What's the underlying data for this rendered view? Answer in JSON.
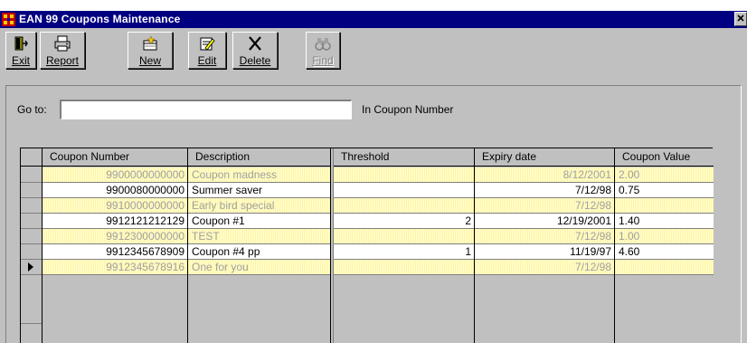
{
  "window": {
    "title": "EAN 99 Coupons Maintenance",
    "titlebar_color": "#000080",
    "close_glyph": "✕"
  },
  "toolbar": {
    "buttons": [
      {
        "label": "Exit",
        "icon": "exit-door-icon"
      },
      {
        "label": "Report",
        "icon": "printer-icon"
      },
      {
        "label": "New",
        "icon": "new-record-icon"
      },
      {
        "label": "Edit",
        "icon": "edit-record-icon"
      },
      {
        "label": "Delete",
        "icon": "delete-x-icon"
      },
      {
        "label": "Find",
        "icon": "binoculars-icon",
        "enabled": false
      }
    ]
  },
  "goto": {
    "label": "Go to:",
    "value": "",
    "suffix": "In Coupon Number"
  },
  "grid": {
    "columns": [
      "Coupon Number",
      "Description",
      "Threshold",
      "Expiry date",
      "Coupon Value"
    ],
    "highlight_color": "#ffffd6",
    "rows": [
      {
        "coupon": "9900000000000",
        "description": "Coupon madness",
        "threshold": "",
        "expiry": "8/12/2001",
        "value": "2.00",
        "style": "hl"
      },
      {
        "coupon": "9900080000000",
        "description": "Summer saver",
        "threshold": "",
        "expiry": "7/12/98",
        "value": "0.75",
        "style": "norm"
      },
      {
        "coupon": "9910000000000",
        "description": "Early bird special",
        "threshold": "",
        "expiry": "7/12/98",
        "value": "",
        "style": "hl"
      },
      {
        "coupon": "9912121212129",
        "description": "Coupon #1",
        "threshold": "2",
        "expiry": "12/19/2001",
        "value": "1.40",
        "style": "norm"
      },
      {
        "coupon": "9912300000000",
        "description": "TEST",
        "threshold": "",
        "expiry": "7/12/98",
        "value": "1.00",
        "style": "hl"
      },
      {
        "coupon": "9912345678909",
        "description": "Coupon #4  pp",
        "threshold": "1",
        "expiry": "11/19/97",
        "value": "4.60",
        "style": "norm"
      },
      {
        "coupon": "9912345678916",
        "description": "One for you",
        "threshold": "",
        "expiry": "7/12/98",
        "value": "",
        "style": "hl",
        "current": true
      }
    ]
  }
}
